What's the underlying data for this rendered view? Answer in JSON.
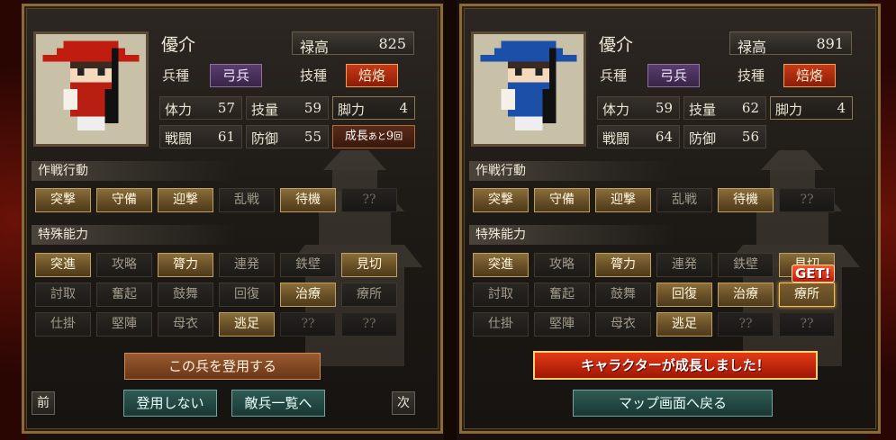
{
  "left": {
    "name": "優介",
    "roku_label": "禄高",
    "roku_value": "825",
    "unit_label": "兵種",
    "unit_value": "弓兵",
    "skill_label": "技種",
    "skill_value": "焙烙",
    "hat_color": "#c01c10",
    "body_color": "#b81f12",
    "stats": {
      "tairyoku": {
        "k": "体力",
        "v": "57"
      },
      "giryo": {
        "k": "技量",
        "v": "59"
      },
      "kyakuryoku": {
        "k": "脚力",
        "v": "4"
      },
      "sento": {
        "k": "戦闘",
        "v": "61"
      },
      "bogyo": {
        "k": "防御",
        "v": "55"
      }
    },
    "growth": {
      "prefix": "成長",
      "mid": "あと",
      "num": "9",
      "suffix": "回"
    },
    "sakusen_title": "作戦行動",
    "sakusen": [
      {
        "label": "突撃",
        "state": "on"
      },
      {
        "label": "守備",
        "state": "on"
      },
      {
        "label": "迎撃",
        "state": "on"
      },
      {
        "label": "乱戦",
        "state": "off"
      },
      {
        "label": "待機",
        "state": "on"
      },
      {
        "label": "??",
        "state": "dim"
      }
    ],
    "tokushu_title": "特殊能力",
    "tokushu": [
      {
        "label": "突進",
        "state": "on"
      },
      {
        "label": "攻略",
        "state": "off"
      },
      {
        "label": "膂力",
        "state": "on"
      },
      {
        "label": "連発",
        "state": "off"
      },
      {
        "label": "鉄壁",
        "state": "off"
      },
      {
        "label": "見切",
        "state": "on"
      },
      {
        "label": "討取",
        "state": "off"
      },
      {
        "label": "奮起",
        "state": "off"
      },
      {
        "label": "鼓舞",
        "state": "off"
      },
      {
        "label": "回復",
        "state": "off"
      },
      {
        "label": "治療",
        "state": "on"
      },
      {
        "label": "療所",
        "state": "off"
      },
      {
        "label": "仕掛",
        "state": "off"
      },
      {
        "label": "堅陣",
        "state": "off"
      },
      {
        "label": "母衣",
        "state": "off"
      },
      {
        "label": "逃足",
        "state": "on"
      },
      {
        "label": "??",
        "state": "dim"
      },
      {
        "label": "??",
        "state": "dim"
      }
    ],
    "recruit_btn": "この兵を登用する",
    "no_recruit_btn": "登用しない",
    "enemy_list_btn": "敵兵一覧へ",
    "prev_btn": "前",
    "next_btn": "次"
  },
  "right": {
    "name": "優介",
    "roku_label": "禄高",
    "roku_value": "891",
    "unit_label": "兵種",
    "unit_value": "弓兵",
    "skill_label": "技種",
    "skill_value": "焙烙",
    "hat_color": "#1c4fa8",
    "body_color": "#1c4fa8",
    "stats": {
      "tairyoku": {
        "k": "体力",
        "v": "59"
      },
      "giryo": {
        "k": "技量",
        "v": "62"
      },
      "kyakuryoku": {
        "k": "脚力",
        "v": "4"
      },
      "sento": {
        "k": "戦闘",
        "v": "64"
      },
      "bogyo": {
        "k": "防御",
        "v": "56"
      }
    },
    "sakusen_title": "作戦行動",
    "sakusen": [
      {
        "label": "突撃",
        "state": "on"
      },
      {
        "label": "守備",
        "state": "on"
      },
      {
        "label": "迎撃",
        "state": "on"
      },
      {
        "label": "乱戦",
        "state": "off"
      },
      {
        "label": "待機",
        "state": "on"
      },
      {
        "label": "??",
        "state": "dim"
      }
    ],
    "tokushu_title": "特殊能力",
    "tokushu": [
      {
        "label": "突進",
        "state": "on"
      },
      {
        "label": "攻略",
        "state": "off"
      },
      {
        "label": "膂力",
        "state": "on"
      },
      {
        "label": "連発",
        "state": "off"
      },
      {
        "label": "鉄壁",
        "state": "off"
      },
      {
        "label": "見切",
        "state": "on"
      },
      {
        "label": "討取",
        "state": "off"
      },
      {
        "label": "奮起",
        "state": "off"
      },
      {
        "label": "鼓舞",
        "state": "off"
      },
      {
        "label": "回復",
        "state": "on"
      },
      {
        "label": "治療",
        "state": "on"
      },
      {
        "label": "療所",
        "state": "highlight"
      },
      {
        "label": "仕掛",
        "state": "off"
      },
      {
        "label": "堅陣",
        "state": "off"
      },
      {
        "label": "母衣",
        "state": "off"
      },
      {
        "label": "逃足",
        "state": "on"
      },
      {
        "label": "??",
        "state": "dim"
      },
      {
        "label": "??",
        "state": "dim"
      }
    ],
    "get_badge": "GET!",
    "grown_banner": "キャラクターが成長しました！",
    "map_btn": "マップ画面へ戻る"
  }
}
